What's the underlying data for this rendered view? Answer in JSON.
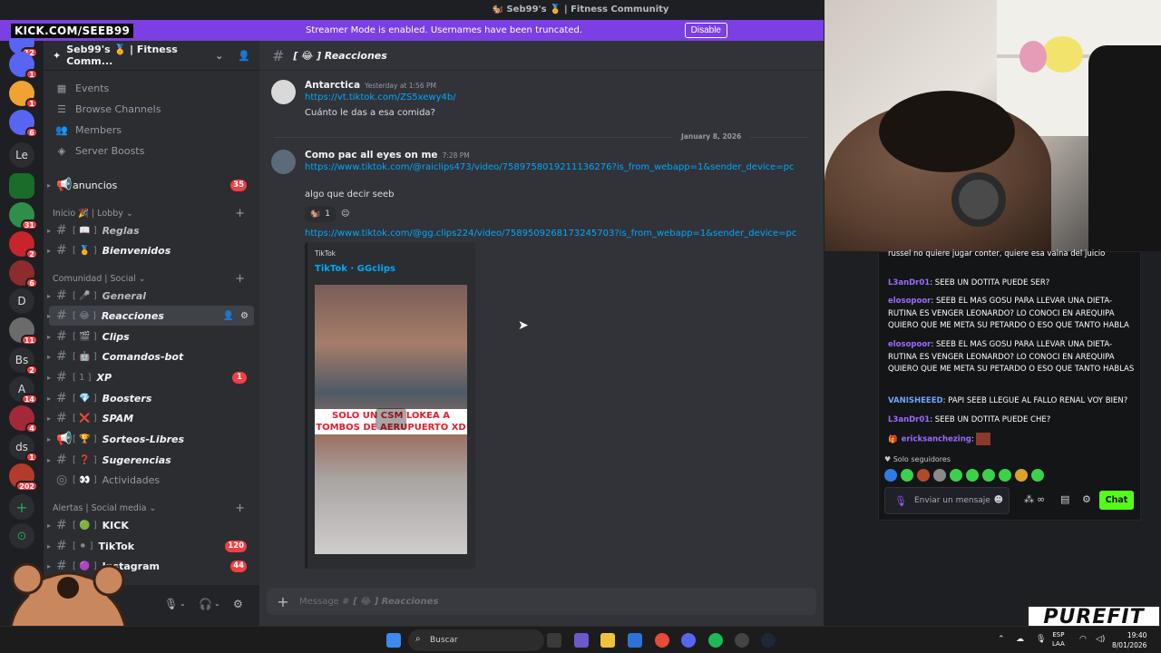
{
  "window": {
    "title": "🐿️ Seb99's 🏅 | Fitness Community"
  },
  "overlay": {
    "kick_handle": "KICK.COM/SEEB99"
  },
  "banner": {
    "text": "Streamer Mode is enabled. Usernames have been truncated.",
    "button": "Disable"
  },
  "rail": {
    "servers": [
      {
        "label": "",
        "badge": "1"
      },
      {
        "label": "",
        "badge": "1"
      },
      {
        "label": "",
        "badge": "6"
      },
      {
        "label": "Le",
        "badge": ""
      },
      {
        "label": "",
        "badge": ""
      },
      {
        "label": "",
        "badge": "31"
      },
      {
        "label": "",
        "badge": "2"
      },
      {
        "label": "",
        "badge": "6"
      },
      {
        "label": "D",
        "badge": ""
      },
      {
        "label": "",
        "badge": "11"
      },
      {
        "label": "Bs",
        "badge": "2"
      },
      {
        "label": "A",
        "badge": "14"
      },
      {
        "label": "",
        "badge": "4"
      },
      {
        "label": "ds",
        "badge": "1"
      },
      {
        "label": "",
        "badge": "202"
      }
    ],
    "top_badge": "12"
  },
  "guild": {
    "name": "Seb99's 🏅 | Fitness Comm..."
  },
  "sidebar": {
    "menu": [
      {
        "label": "Events",
        "icon": "calendar-icon"
      },
      {
        "label": "Browse Channels",
        "icon": "browse-icon"
      },
      {
        "label": "Members",
        "icon": "members-icon"
      },
      {
        "label": "Server Boosts",
        "icon": "boost-icon"
      }
    ],
    "announce": {
      "label": "anuncios",
      "badge": "35"
    },
    "categories": [
      {
        "label": "Inicio 🎉 | Lobby"
      },
      {
        "label": "Comunidad | Social"
      },
      {
        "label": "Alertas | Social media"
      }
    ],
    "channels": [
      {
        "emoji": "[ 📖 ]",
        "name": "Reglas",
        "badge": ""
      },
      {
        "emoji": "[ 🏅 ]",
        "name": "Bienvenidos",
        "badge": ""
      },
      {
        "emoji": "[ 🎤 ]",
        "name": "General",
        "badge": ""
      },
      {
        "emoji": "[ 😂 ]",
        "name": "Reacciones",
        "badge": ""
      },
      {
        "emoji": "[ 🎬 ]",
        "name": "Clips",
        "badge": ""
      },
      {
        "emoji": "[ 🤖 ]",
        "name": "Comandos-bot",
        "badge": ""
      },
      {
        "emoji": "[ 1 ]",
        "name": "XP",
        "badge": "1"
      },
      {
        "emoji": "[ 💎 ]",
        "name": "Boosters",
        "badge": ""
      },
      {
        "emoji": "[ ❌ ]",
        "name": "SPAM",
        "badge": ""
      },
      {
        "emoji": "[ 🏆 ]",
        "name": "Sorteos-Libres",
        "badge": ""
      },
      {
        "emoji": "[ ❓ ]",
        "name": "Sugerencias",
        "badge": ""
      },
      {
        "emoji": "[ 👀 ]",
        "name": "Actividades",
        "badge": ""
      },
      {
        "emoji": "[ 🟢 ]",
        "name": "KICK",
        "badge": ""
      },
      {
        "emoji": "[ ⚫ ]",
        "name": "TikTok",
        "badge": "120"
      },
      {
        "emoji": "[ 🟣 ]",
        "name": "Instagram",
        "badge": "44"
      }
    ]
  },
  "chat": {
    "channel": "[ 😂 ] Reacciones",
    "messages": [
      {
        "author": "Antarctica",
        "time": "Yesterday at 1:56 PM",
        "lines": [
          "https://vt.tiktok.com/ZS5xewy4b/",
          "Cuánto le das a esa comida?"
        ]
      },
      {
        "author": "Como pac all eyes on me",
        "time": "7:28 PM",
        "lines": [
          "https://www.tiktok.com/@raiclips473/video/7589758019211136276?is_from_webapp=1&sender_device=pc",
          "algo que decir seeb",
          "https://www.tiktok.com/@gg.clips224/video/7589509268173245703?is_from_webapp=1&sender_device=pc"
        ]
      }
    ],
    "date_divider": "January 8, 2026",
    "reaction_count": "1",
    "embed": {
      "provider": "TikTok",
      "title": "TikTok · GGclips",
      "caption": "SOLO UN CSM LOKEA A TOMBOS DE AERUPUERTO XD"
    },
    "composer": {
      "prefix": "Message #",
      "channel": "[ 😂 ] Reacciones"
    }
  },
  "kick": {
    "messages": [
      {
        "user": "",
        "text": "russel no quiere jugar conter, quiere esa vaina del juicio",
        "color": "#9b6bff"
      },
      {
        "user": "L3anDr01",
        "text": "SEEB UN DOTITA PUEDE SER?",
        "color": "#9b6bff"
      },
      {
        "user": "elosopoor",
        "text": "SEEB EL MAS GOSU PARA LLEVAR UNA DIETA-RUTINA ES VENGER LEONARDO? LO CONOCI EN AREQUIPA QUIERO QUE ME META SU PETARDO O ESO QUE TANTO HABLA",
        "color": "#9b6bff"
      },
      {
        "user": "elosopoor",
        "text": "SEEB EL MAS GOSU PARA LLEVAR UNA DIETA-RUTINA ES VENGER LEONARDO? LO CONOCI EN AREQUIPA QUIERO QUE ME META SU PETARDO O ESO QUE TANTO HABLAS",
        "color": "#9b6bff"
      },
      {
        "user": "VANISHEEED",
        "text": "PAPI SEEB LLEGUE AL FALLO RENAL VOY BIEN?",
        "color": "#6ea8ff"
      },
      {
        "user": "L3anDr01",
        "text": "SEEB UN DOTITA PUEDE CHE?",
        "color": "#9b6bff"
      },
      {
        "user": "ericksanchezing",
        "text": "",
        "color": "#9b6bff"
      }
    ],
    "followers_only": "Solo seguidores",
    "input_placeholder": "Enviar un mensaje",
    "send": "Chat",
    "infinity": "∞"
  },
  "brand": {
    "logo": "PUREFIT"
  },
  "taskbar": {
    "search": "Buscar",
    "lang": "ESP",
    "lang2": "LAA",
    "time": "19:40",
    "date": "8/01/2026"
  }
}
